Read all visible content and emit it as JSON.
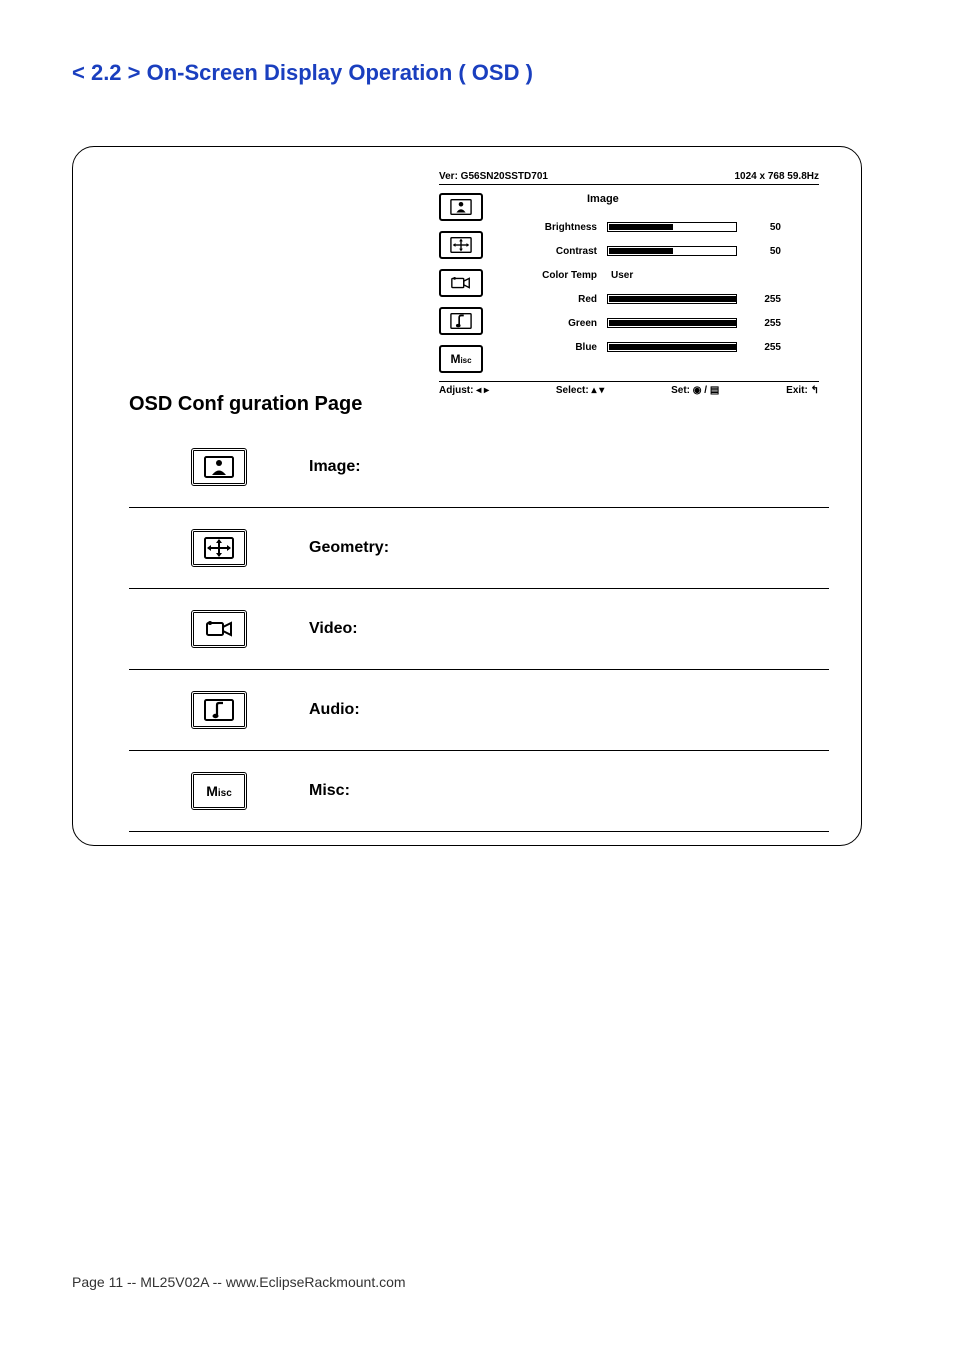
{
  "title": "< 2.2 > On-Screen Display Operation ( OSD )",
  "osd": {
    "version": "Ver: G56SN20SSTD701",
    "resolution": "1024 x 768  59.8Hz",
    "section": "Image",
    "settings": {
      "brightness_label": "Brightness",
      "brightness_value": "50",
      "brightness_pct": 50,
      "contrast_label": "Contrast",
      "contrast_value": "50",
      "contrast_pct": 50,
      "colortemp_label": "Color Temp",
      "colortemp_value": "User",
      "red_label": "Red",
      "red_value": "255",
      "red_pct": 100,
      "green_label": "Green",
      "green_value": "255",
      "green_pct": 100,
      "blue_label": "Blue",
      "blue_value": "255",
      "blue_pct": 100
    },
    "hints": {
      "adjust": "Adjust: ◂ ▸",
      "select": "Select: ▴ ▾",
      "set": "Set: ◉ / ▤",
      "exit": "Exit: ↰"
    }
  },
  "conf_title": "OSD Conf guration Page",
  "conf_items": {
    "image": "Image:",
    "geometry": "Geometry:",
    "video": "Video:",
    "audio": "Audio:",
    "misc": "Misc:"
  },
  "misc_icon_text_big": "M",
  "misc_icon_text_sub": "isc",
  "footer": "Page 11 -- ML25V02A -- www.EclipseRackmount.com"
}
